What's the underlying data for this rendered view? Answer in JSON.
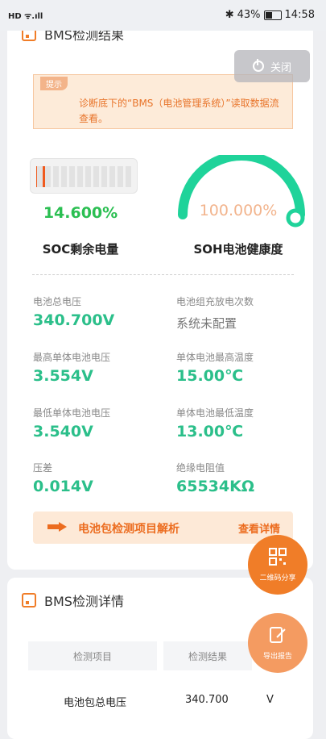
{
  "status_bar": {
    "left": "HD ᯤ.ıll",
    "bluetooth": "✱",
    "battery_pct": "43%",
    "time": "14:58"
  },
  "card1": {
    "title": "BMS检测结果",
    "close_label": "关闭",
    "tip_tag": "提示",
    "tip_text": "诊断底下的“BMS（电池管理系统）”读取数据流查看。",
    "soc_value": "14.600%",
    "soc_label": "SOC剩余电量",
    "soc_fraction": 0.146,
    "soh_value": "100.000%",
    "soh_label": "SOH电池健康度",
    "soh_fraction": 1.0,
    "metrics": [
      {
        "label": "电池总电压",
        "value": "340.700V"
      },
      {
        "label": "电池组充放电次数",
        "value": "系统未配置"
      },
      {
        "label": "最高单体电池电压",
        "value": "3.554V"
      },
      {
        "label": "单体电池最高温度",
        "value": "15.00℃"
      },
      {
        "label": "最低单体电池电压",
        "value": "3.540V"
      },
      {
        "label": "单体电池最低温度",
        "value": "13.00℃"
      },
      {
        "label": "压差",
        "value": "0.014V"
      },
      {
        "label": "绝缘电阻值",
        "value": "65534KΩ"
      }
    ],
    "banner_title": "电池包检测项目解析",
    "banner_link": "查看详情"
  },
  "fabs": {
    "qr_share": "二维码分享",
    "export_report": "导出报告"
  },
  "card2": {
    "title": "BMS检测详情",
    "col_item": "检测项目",
    "col_result": "检测结果",
    "row1": {
      "item": "电池包总电压",
      "value": "340.700",
      "unit": "V"
    }
  },
  "colors": {
    "accent": "#f07d28",
    "green": "#2bbf8a",
    "gauge": "#1fd39a"
  }
}
